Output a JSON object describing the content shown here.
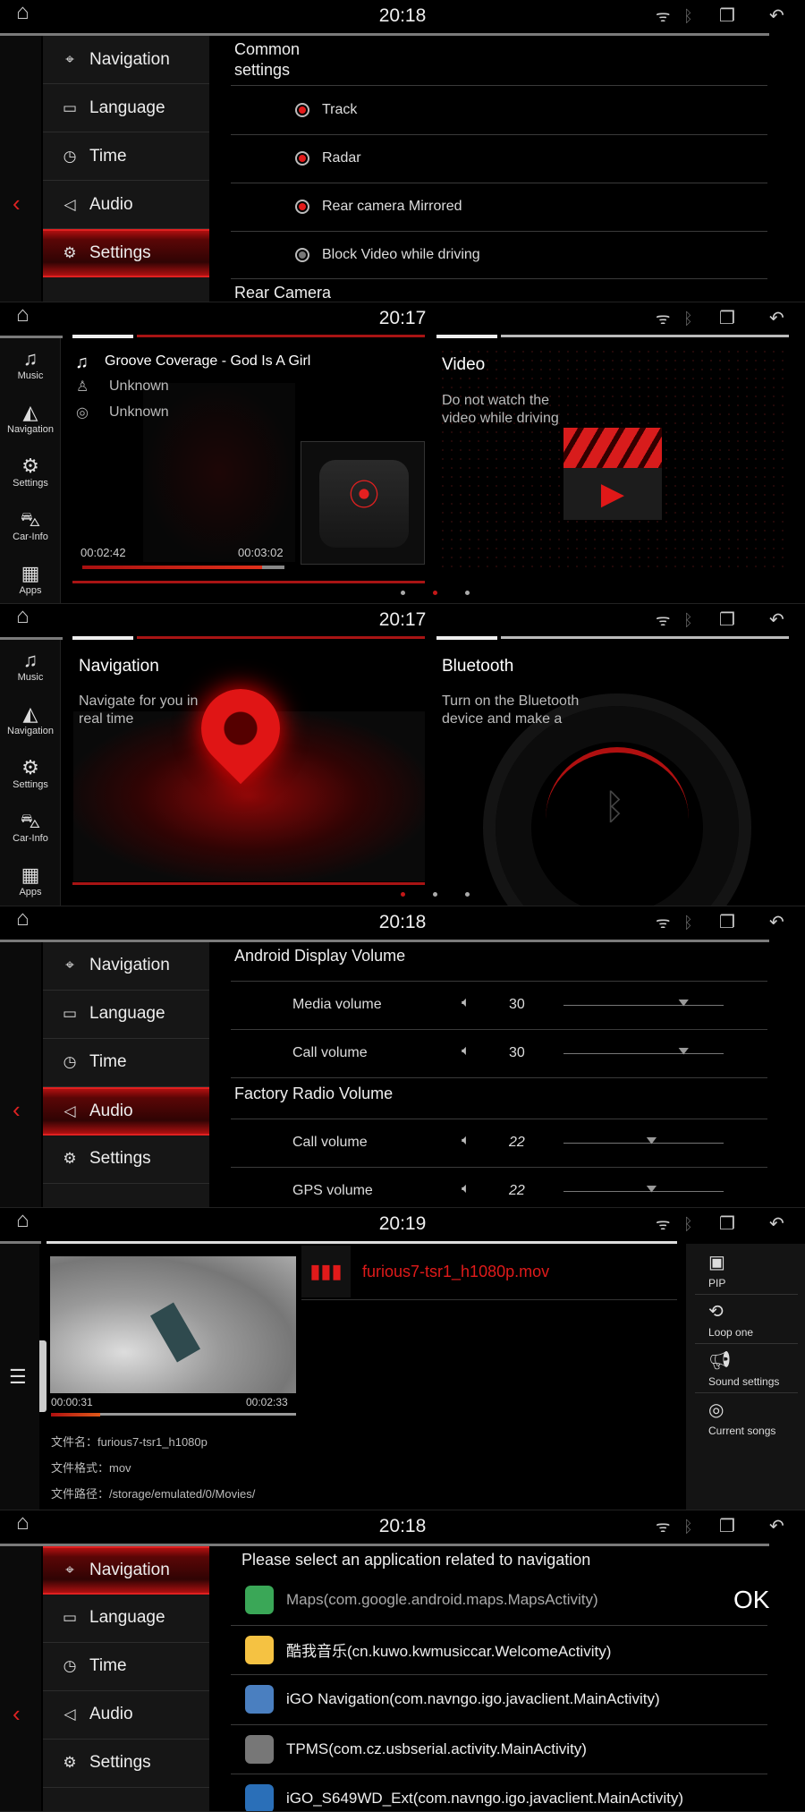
{
  "colors": {
    "accent": "#e21a1a",
    "background": "#000000",
    "menu": "#161616"
  },
  "status": {
    "icons": [
      "home-icon",
      "wifi-icon",
      "bluetooth-icon",
      "recent-apps-icon",
      "back-icon"
    ]
  },
  "settings_menu": [
    "Navigation",
    "Language",
    "Time",
    "Audio",
    "Settings"
  ],
  "side_menu": [
    "Music",
    "Navigation",
    "Settings",
    "Car-Info",
    "Apps"
  ],
  "screens": [
    {
      "time": "20:18",
      "selected": "Settings",
      "header1": "Common",
      "header2": "settings",
      "options": [
        {
          "label": "Track",
          "on": true
        },
        {
          "label": "Radar",
          "on": true
        },
        {
          "label": "Rear camera Mirrored",
          "on": true
        },
        {
          "label": "Block Video while driving",
          "on": false
        }
      ],
      "next_header": "Rear Camera"
    },
    {
      "time": "20:17",
      "music": {
        "title": "Groove Coverage - God Is A Girl",
        "artist": "Unknown",
        "album": "Unknown",
        "elapsed": "00:02:42",
        "duration": "00:03:02",
        "progress": 0.89
      },
      "video": {
        "title": "Video",
        "line1": "Do not watch the",
        "line2": "video while driving"
      },
      "page": 2,
      "pages": 3
    },
    {
      "time": "20:17",
      "navigation": {
        "title": "Navigation",
        "line1": "Navigate for you in",
        "line2": "real time"
      },
      "bluetooth": {
        "title": "Bluetooth",
        "line1": "Turn on the Bluetooth",
        "line2": "device and make a"
      },
      "page": 1,
      "pages": 3
    },
    {
      "time": "20:18",
      "selected": "Audio",
      "groups": [
        {
          "title": "Android Display Volume",
          "rows": [
            {
              "label": "Media volume",
              "value": "30",
              "level": 0.75
            },
            {
              "label": "Call volume",
              "value": "30",
              "level": 0.75
            }
          ]
        },
        {
          "title": "Factory Radio Volume",
          "rows": [
            {
              "label": "Call volume",
              "value": "22",
              "level": 0.55
            },
            {
              "label": "GPS volume",
              "value": "22",
              "level": 0.55
            }
          ]
        }
      ]
    },
    {
      "time": "20:19",
      "player": {
        "file": "furious7-tsr1_h1080p.mov",
        "elapsed": "00:00:31",
        "duration": "00:02:33",
        "progress": 0.2,
        "info": [
          "文件名：furious7-tsr1_h1080p",
          "文件格式：mov",
          "文件路径：/storage/emulated/0/Movies/"
        ]
      },
      "actions": [
        {
          "label": "PIP",
          "icon": "pip-icon"
        },
        {
          "label": "Loop one",
          "icon": "loop-one-icon"
        },
        {
          "label": "Sound settings",
          "icon": "sound-settings-icon"
        },
        {
          "label": "Current songs",
          "icon": "current-songs-icon"
        }
      ]
    },
    {
      "time": "20:18",
      "selected": "Navigation",
      "title": "Please select an application related to navigation",
      "ok": "OK",
      "apps": [
        {
          "label": "Maps(com.google.android.maps.MapsActivity)",
          "color": "#3aa757"
        },
        {
          "label": "酷我音乐(cn.kuwo.kwmusiccar.WelcomeActivity)",
          "color": "#f5c242"
        },
        {
          "label": "iGO Navigation(com.navngo.igo.javaclient.MainActivity)",
          "color": "#4a7fc0"
        },
        {
          "label": "TPMS(com.cz.usbserial.activity.MainActivity)",
          "color": "#777777"
        },
        {
          "label": "iGO_S649WD_Ext(com.navngo.igo.javaclient.MainActivity)",
          "color": "#2a6fb8"
        }
      ]
    }
  ]
}
